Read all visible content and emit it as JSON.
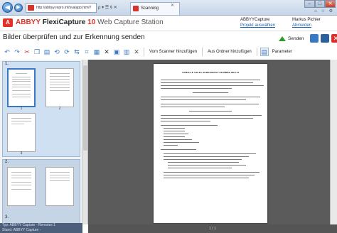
{
  "browser": {
    "address": "http://abbyy.repro.inf/svalapp.html?",
    "address_controls": "ρ ▾ ☰ ¢ ✕",
    "tab_title": "Scanning",
    "tab_close": "✕",
    "window_controls": [
      "–",
      "□",
      "✕"
    ],
    "right_icons": "⌂ ☆ ⚙",
    "nav_back": "◀",
    "nav_forward": "▶"
  },
  "app": {
    "logo_mark": "A",
    "brand": "ABBYY",
    "product": "FlexiCapture",
    "version": "10",
    "station": "Web Capture Station",
    "user1_name": "ABBYYCapture",
    "user1_link": "Projekt auswählen",
    "user2_name": "Markus Pichler",
    "user2_link": "Abmelden"
  },
  "page_title": "Bilder überprüfen und zur Erkennung senden",
  "send_label": "Senden",
  "toolbar": {
    "scan_from_scanner": "Vom Scanner hinzufügen",
    "add_from_folder": "Aus Ordner hinzufügen",
    "parameters": "Parameter"
  },
  "batches": [
    {
      "label": "1.",
      "pages": [
        "1",
        "2",
        "3"
      ]
    },
    {
      "label": "2.",
      "pages": [
        "",
        ""
      ]
    },
    {
      "label": "3.",
      "pages": []
    }
  ],
  "status_left_line1": "Typ: ABBYY Capture - Remotes 1",
  "status_left_line2": "Stand: ABBYY Capture -",
  "status_main": "1 / 1",
  "document": {
    "title": "VEHICLE SALES AGREEMENT NUMBER 400 123"
  },
  "colors": {
    "brand_red": "#e1322a",
    "accent_blue": "#3a78c2",
    "send_green": "#2e9a2c"
  }
}
